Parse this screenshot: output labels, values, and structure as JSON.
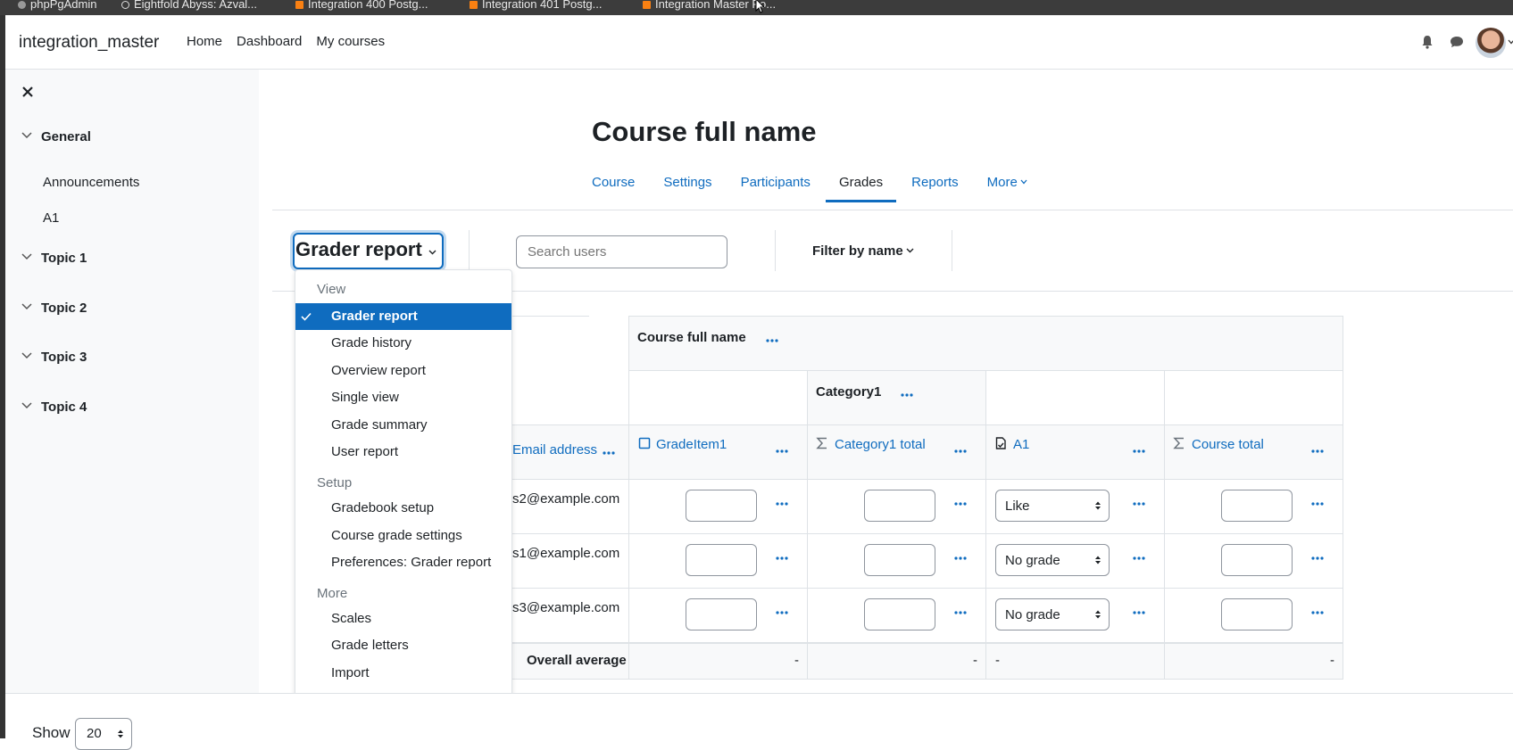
{
  "bookmarks": [
    {
      "label": "phpPgAdmin",
      "icon": "gray-circle-icon"
    },
    {
      "label": "Eightfold Abyss: Azval...",
      "icon": "globe-icon"
    },
    {
      "label": "Integration 400 Postg...",
      "icon": "moodle-icon"
    },
    {
      "label": "Integration 401 Postg...",
      "icon": "moodle-icon"
    },
    {
      "label": "Integration Master Po...",
      "icon": "moodle-icon"
    }
  ],
  "navbar": {
    "brand": "integration_master",
    "links": [
      "Home",
      "Dashboard",
      "My courses"
    ]
  },
  "drawer": {
    "sections": [
      {
        "title": "General",
        "activities": [
          "Announcements",
          "A1"
        ]
      },
      {
        "title": "Topic 1",
        "activities": []
      },
      {
        "title": "Topic 2",
        "activities": []
      },
      {
        "title": "Topic 3",
        "activities": []
      },
      {
        "title": "Topic 4",
        "activities": []
      }
    ]
  },
  "course": {
    "title": "Course full name",
    "tabs": [
      "Course",
      "Settings",
      "Participants",
      "Grades",
      "Reports",
      "More"
    ],
    "active_tab": "Grades"
  },
  "toolbar": {
    "report_select": "Grader report",
    "search_placeholder": "Search users",
    "filter_label": "Filter by name"
  },
  "dropdown": {
    "groups": [
      {
        "heading": "View",
        "items": [
          "Grader report",
          "Grade history",
          "Overview report",
          "Single view",
          "Grade summary",
          "User report"
        ]
      },
      {
        "heading": "Setup",
        "items": [
          "Gradebook setup",
          "Course grade settings",
          "Preferences: Grader report"
        ]
      },
      {
        "heading": "More",
        "items": [
          "Scales",
          "Grade letters",
          "Import"
        ]
      }
    ],
    "selected": "Grader report"
  },
  "grader": {
    "course_header": "Course full name",
    "category_header": "Category1",
    "email_column": "Email address",
    "columns": [
      {
        "label": "GradeItem1",
        "icon": "manual-item-icon"
      },
      {
        "label": "Category1 total",
        "icon": "sigma-icon"
      },
      {
        "label": "A1",
        "icon": "assignment-icon"
      },
      {
        "label": "Course total",
        "icon": "sigma-icon"
      }
    ],
    "rows": [
      {
        "email": "s2@example.com",
        "a1": "Like"
      },
      {
        "email": "s1@example.com",
        "a1": "No grade"
      },
      {
        "email": "s3@example.com",
        "a1": "No grade"
      }
    ],
    "average_label": "Overall average",
    "averages": [
      "-",
      "-",
      "-",
      "-"
    ]
  },
  "footer": {
    "show_label": "Show",
    "per_page": "20"
  },
  "colors": {
    "accent": "#0f6cbf",
    "drawer_bg": "#f8f9fa",
    "text": "#1d2125"
  }
}
